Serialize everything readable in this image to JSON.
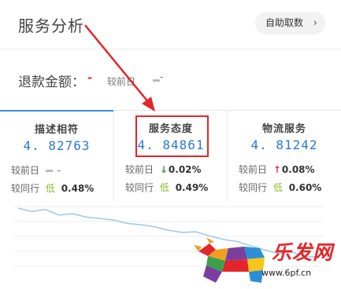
{
  "header": {
    "title": "服务分析",
    "auto_button": "自助取数",
    "auto_button_chevron": "chevron-right-icon"
  },
  "refund": {
    "label": "退款金额：",
    "value": "-",
    "compare_label": "较前日",
    "compare_value": "-"
  },
  "cards": [
    {
      "name": "描述相符",
      "value": "4. 82763",
      "active": true,
      "prev_day_label": "较前日",
      "prev_day_value": "-",
      "prev_day_direction": "none",
      "peer_label": "较同行",
      "peer_badge": "低",
      "peer_value": "0.48%"
    },
    {
      "name": "服务态度",
      "value": "4. 84861",
      "active": false,
      "prev_day_label": "较前日",
      "prev_day_value": "0.02%",
      "prev_day_direction": "down",
      "peer_label": "较同行",
      "peer_badge": "低",
      "peer_value": "0.49%"
    },
    {
      "name": "物流服务",
      "value": "4. 81242",
      "active": false,
      "prev_day_label": "较前日",
      "prev_day_value": "0.08%",
      "prev_day_direction": "up",
      "peer_label": "较同行",
      "peer_badge": "低",
      "peer_value": "0.60%"
    }
  ],
  "colors": {
    "accent": "#2a78d6",
    "active_tab": "#3a8ee6",
    "annotation_red": "#e4262a",
    "down_green": "#2e9e3d",
    "up_red": "#e4393c",
    "low_badge": "#8fb82c",
    "trend_line": "#9cc7ea"
  },
  "trend_line": {
    "series": [
      4.86,
      4.855,
      4.858,
      4.85,
      4.852,
      4.847,
      4.845,
      4.843,
      4.838,
      4.836,
      4.833,
      4.828,
      4.825,
      4.826,
      4.82,
      4.815,
      4.812,
      4.806,
      4.8,
      4.795,
      4.797,
      4.79,
      4.79
    ]
  },
  "watermark": {
    "logo_text": "乐发网",
    "url": "www.6pf.cn"
  },
  "annotations": {
    "arrow": "arrow-annotation-icon",
    "box": "highlight-box"
  }
}
